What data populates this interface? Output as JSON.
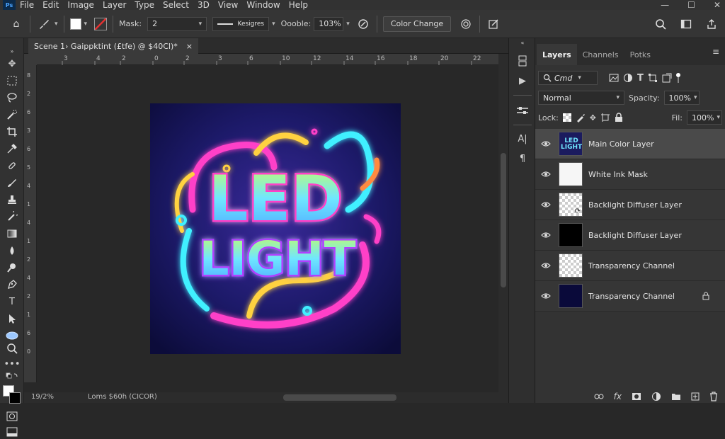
{
  "app": {
    "logo": "Ps"
  },
  "menu": [
    "File",
    "Edit",
    "Image",
    "Layer",
    "Type",
    "Select",
    "3D",
    "View",
    "Window",
    "Help"
  ],
  "window_controls": {
    "minimize": "—",
    "maximize": "☐",
    "close": "✕"
  },
  "options": {
    "mask_label": "Mask:",
    "mask_value": "2",
    "stroke_label": "Kesigres",
    "opacity_label": "Oooble:",
    "opacity_value": "103%",
    "color_change_label": "Color Change"
  },
  "document": {
    "tab_title": "Scene 1› Gaippktint (£tfe) @ $40Cl)*",
    "tab_close": "×",
    "status_zoom": "19/2%",
    "status_info": "Loms $60h (CICOR)"
  },
  "ruler_h": [
    "3",
    "4",
    "2",
    "0",
    "2",
    "3",
    "6",
    "10",
    "12",
    "14",
    "16",
    "18",
    "20",
    "22"
  ],
  "ruler_v": [
    "8",
    "2",
    "6",
    "3",
    "6",
    "5",
    "4",
    "1",
    "4",
    "1",
    "2",
    "4",
    "2",
    "1",
    "6",
    "0"
  ],
  "artwork": {
    "line1": "LED",
    "line2": "LIGHT",
    "thumb_text": "LED LIGHT"
  },
  "colors": {
    "bg_dark": "#282828",
    "art_bg": "#1b1b5e",
    "neon_pink": "#ff3fc8",
    "neon_cyan": "#3ff0ff",
    "neon_yellow": "#ffd23f"
  },
  "panel": {
    "tabs": [
      "Layers",
      "Channels",
      "Potks"
    ],
    "search_placeholder": "Cmd",
    "blend_mode": "Normal",
    "spacity_label": "Spacity:",
    "spacity_value": "100%",
    "lock_label": "Lock:",
    "fill_label": "Fil:",
    "fill_value": "100%"
  },
  "layers": [
    {
      "name": "Main Color Layer",
      "thumb": "art",
      "selected": true
    },
    {
      "name": "White Ink Mask",
      "thumb": "white"
    },
    {
      "name": "Backlight Diffuser Layer",
      "thumb": "checker-link"
    },
    {
      "name": "Backlight Diffuser Layer",
      "thumb": "black"
    },
    {
      "name": "Transparency Channel",
      "thumb": "checker"
    },
    {
      "name": "Transparency Channel",
      "thumb": "navy",
      "locked": true
    }
  ],
  "footer_icons": [
    "link-icon",
    "fx-icon",
    "mask-icon",
    "adjustment-icon",
    "folder-icon",
    "new-layer-icon",
    "trash-icon"
  ]
}
